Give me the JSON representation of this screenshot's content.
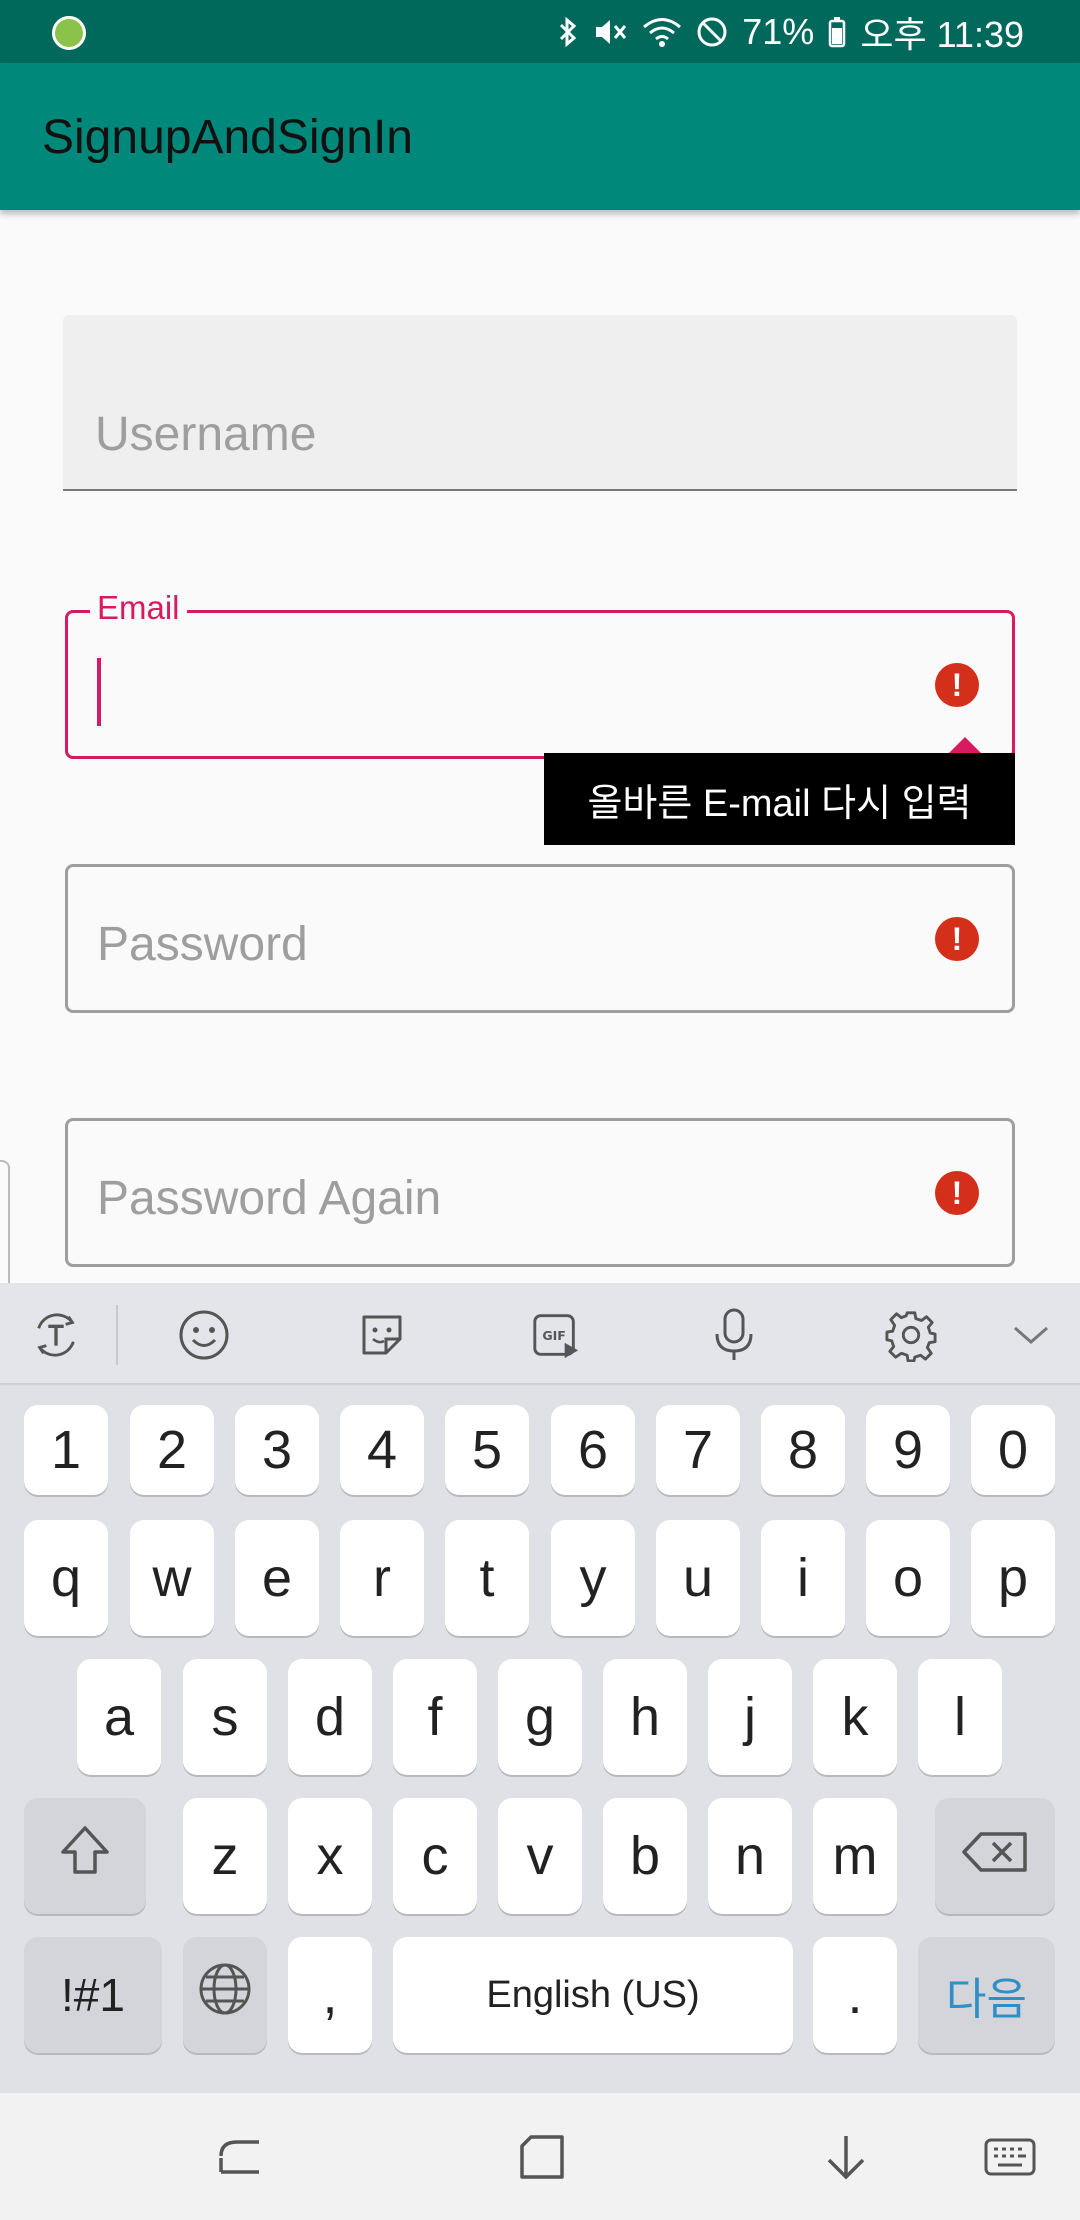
{
  "status_bar": {
    "battery": "71%",
    "clock": "오후 11:39",
    "icons": [
      "app-notification-icon",
      "bluetooth-icon",
      "mute-icon",
      "wifi-icon",
      "do-not-disturb-icon",
      "battery-icon"
    ]
  },
  "app_bar": {
    "title": "SignupAndSignIn"
  },
  "form": {
    "username": {
      "placeholder": "Username",
      "value": ""
    },
    "email": {
      "label": "Email",
      "value": "",
      "error_tooltip": "올바른 E-mail 다시 입력"
    },
    "password": {
      "placeholder": "Password",
      "value": ""
    },
    "password_again": {
      "placeholder": "Password Again",
      "value": ""
    },
    "error_glyph": "!"
  },
  "colors": {
    "status_bar": "#00695c",
    "app_bar": "#00897b",
    "error": "#d81b60",
    "error_icon": "#d32f1a",
    "enter_key_text": "#2f8fc6"
  },
  "keyboard": {
    "toolbar_icons": [
      "text-translate-icon",
      "emoji-icon",
      "sticker-icon",
      "gif-icon",
      "microphone-icon",
      "settings-gear-icon",
      "collapse-chevron-icon"
    ],
    "number_row": [
      "1",
      "2",
      "3",
      "4",
      "5",
      "6",
      "7",
      "8",
      "9",
      "0"
    ],
    "row1": [
      "q",
      "w",
      "e",
      "r",
      "t",
      "y",
      "u",
      "i",
      "o",
      "p"
    ],
    "row2": [
      "a",
      "s",
      "d",
      "f",
      "g",
      "h",
      "j",
      "k",
      "l"
    ],
    "row3": [
      "z",
      "x",
      "c",
      "v",
      "b",
      "n",
      "m"
    ],
    "symbols_key": "!#1",
    "comma_key": ",",
    "space_key": "English (US)",
    "period_key": ".",
    "enter_key": "다음"
  },
  "nav_bar": {
    "icons": [
      "recent-apps-icon",
      "home-icon",
      "back-icon",
      "keyboard-switch-icon"
    ]
  }
}
